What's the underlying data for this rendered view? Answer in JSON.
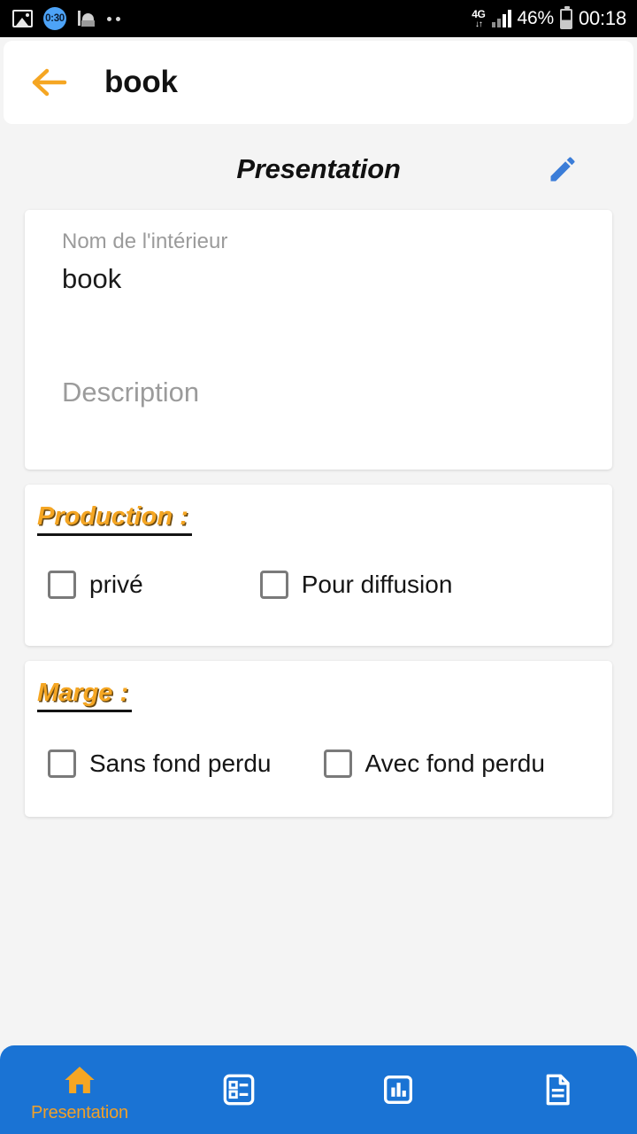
{
  "status_bar": {
    "timer_badge": "0:30",
    "network_type": "4G",
    "battery_percent": "46%",
    "clock": "00:18",
    "icons": [
      "image-icon",
      "timer-icon",
      "mosque-icon",
      "more-dots-icon",
      "network-4g-icon",
      "signal-icon",
      "battery-icon"
    ]
  },
  "appbar": {
    "back_icon": "back-arrow-icon",
    "title": "book"
  },
  "page_head": {
    "title": "Presentation",
    "edit_icon": "pencil-edit-icon"
  },
  "info_card": {
    "name_label": "Nom de l'intérieur",
    "name_value": "book",
    "description_placeholder": "Description"
  },
  "production_card": {
    "title": "Production :",
    "options": [
      {
        "label": "privé",
        "checked": false
      },
      {
        "label": "Pour diffusion",
        "checked": false
      }
    ]
  },
  "marge_card": {
    "title": "Marge :",
    "options": [
      {
        "label": "Sans fond perdu",
        "checked": false
      },
      {
        "label": "Avec fond perdu",
        "checked": false
      }
    ]
  },
  "bottom_nav": {
    "items": [
      {
        "label": "Presentation",
        "icon": "home-icon",
        "active": true
      },
      {
        "label": "",
        "icon": "list-view-icon",
        "active": false
      },
      {
        "label": "",
        "icon": "bar-chart-icon",
        "active": false
      },
      {
        "label": "",
        "icon": "document-icon",
        "active": false
      }
    ]
  },
  "colors": {
    "accent_orange": "#f5a623",
    "nav_blue": "#1a73d4",
    "edit_blue": "#3b7dd8",
    "page_background": "#f4f4f4",
    "card_background": "#ffffff"
  }
}
